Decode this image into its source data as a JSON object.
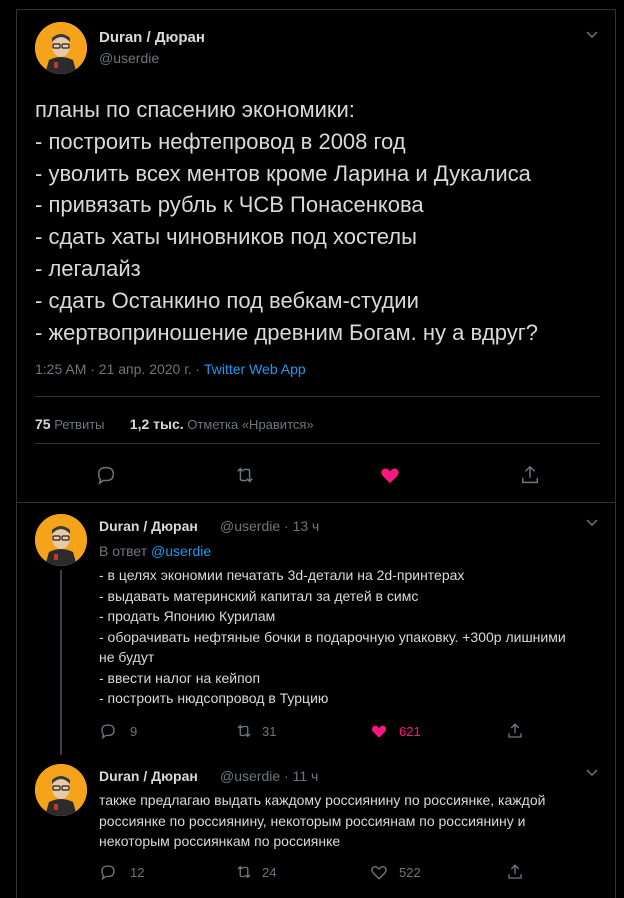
{
  "main_tweet": {
    "author_name": "Duran / Дюран",
    "handle": "@userdie",
    "text": "планы по спасению экономики:\n- построить нефтепровод в 2008 год\n- уволить всех ментов кроме Ларина и Дукалиса\n- привязать рубль к ЧСВ Понасенкова\n- сдать хаты чиновников под хостелы\n- легалайз\n- сдать Останкино под вебкам-студии\n- жертвоприношение древним Богам. ну а вдруг?",
    "timestamp": "1:25 AM · 21 апр. 2020 г. · ",
    "source": "Twitter Web App",
    "retweets_count": "75",
    "retweets_label": "Ретвиты",
    "likes_count": "1,2 тыс.",
    "likes_label": "Отметка «Нравится»",
    "liked": true
  },
  "replies": [
    {
      "author_name": "Duran / Дюран",
      "handle": "@userdie · 13 ч",
      "reply_to_label": "В ответ ",
      "reply_to_handle": "@userdie",
      "text": "- в целях экономии печатать 3d-детали на 2d-принтерах\n- выдавать материнский капитал за детей в симс\n- продать Японию Курилам\n- оборачивать нефтяные бочки в подарочную упаковку. +300р лишними не будут\n- ввести налог на кейпоп\n- построить нюдсопровод в Турцию",
      "reply_count": "9",
      "retweet_count": "31",
      "like_count": "621",
      "liked": true
    },
    {
      "author_name": "Duran / Дюран",
      "handle": "@userdie · 11 ч",
      "text": "также предлагаю выдать каждому россиянину по россиянке, каждой россиянке по россиянину, некоторым россиянам по россиянину и некоторым россиянкам по россиянке",
      "reply_count": "12",
      "retweet_count": "24",
      "like_count": "522",
      "liked": false
    }
  ],
  "colors": {
    "background": "#000000",
    "text": "#d9d9d9",
    "secondary": "#6e767d",
    "link": "#1d9bf0",
    "like": "#f91880",
    "avatar_bg": "#f5a31a"
  },
  "icons": [
    "reply-icon",
    "retweet-icon",
    "like-icon",
    "share-icon",
    "chevron-down-icon"
  ]
}
